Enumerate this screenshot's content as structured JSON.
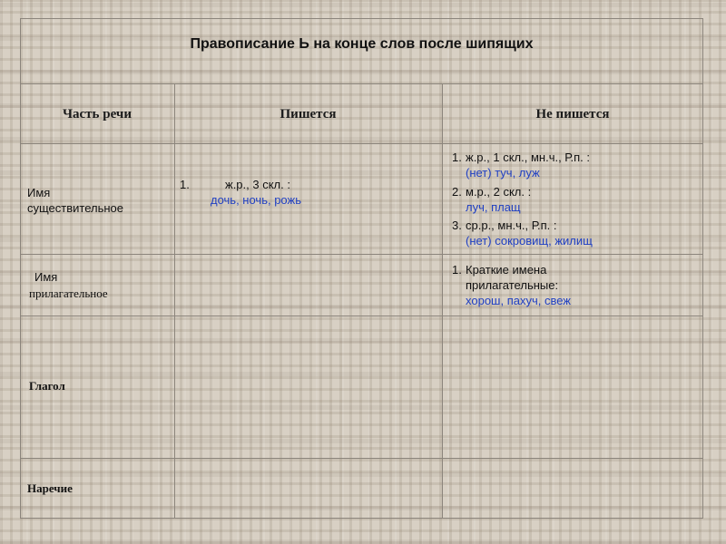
{
  "title": "Правописание Ь на конце слов после шипящих",
  "headers": {
    "part_of_speech": "Часть речи",
    "written": "Пишется",
    "not_written": "Не пишется"
  },
  "rows": {
    "noun": {
      "label_line1": "Имя",
      "label_line2": "существительное",
      "written_marker": "1.",
      "written_rule": "ж.р., 3 скл. :",
      "written_examples": "дочь, ночь, рожь",
      "not_written": [
        {
          "marker": "1.",
          "rule": "ж.р., 1 скл., мн.ч.,  Р.п. :",
          "examples": "(нет) туч, луж"
        },
        {
          "marker": "2.",
          "rule": "м.р., 2 скл. :",
          "examples": "луч, плащ"
        },
        {
          "marker": "3.",
          "rule": "ср.р., мн.ч.,  Р.п. :",
          "examples": "(нет) сокровищ, жилищ"
        }
      ]
    },
    "adjective": {
      "label_line1": "Имя",
      "label_line2": "прилагательное",
      "not_written": {
        "marker": "1.",
        "rule_line1": "Краткие имена",
        "rule_line2": "прилагательные:",
        "examples": "хорош, пахуч, свеж"
      }
    },
    "verb": {
      "label": "Глагол"
    },
    "adverb": {
      "label": "Наречие"
    }
  },
  "colors": {
    "example_text": "#1f3fc2",
    "grid_lines": "#8c857c",
    "background": "#d8d0c4"
  }
}
